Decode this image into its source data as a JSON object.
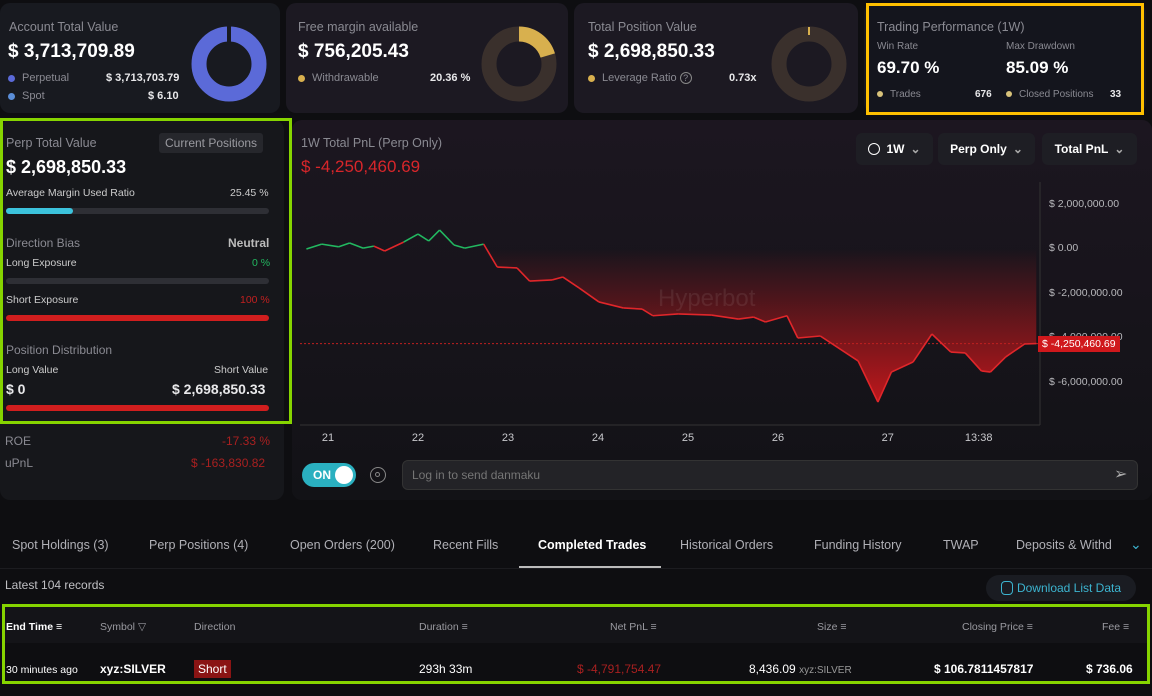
{
  "cards": {
    "account": {
      "title": "Account Total Value",
      "value": "$ 3,713,709.89",
      "rows": [
        {
          "label": "Perpetual",
          "value": "$ 3,713,703.79"
        },
        {
          "label": "Spot",
          "value": "$ 6.10"
        }
      ]
    },
    "free_margin": {
      "title": "Free margin available",
      "value": "$ 756,205.43",
      "row": {
        "label": "Withdrawable",
        "value": "20.36 %"
      },
      "fraction": 0.2036
    },
    "position": {
      "title": "Total Position Value",
      "value": "$ 2,698,850.33",
      "row": {
        "label": "Leverage Ratio",
        "value": "0.73x"
      }
    },
    "performance": {
      "title": "Trading Performance (1W)",
      "win_rate_label": "Win Rate",
      "win_rate": "69.70 %",
      "drawdown_label": "Max Drawdown",
      "drawdown": "85.09 %",
      "trades_label": "Trades",
      "trades": "676",
      "closed_label": "Closed Positions",
      "closed": "33"
    }
  },
  "perp": {
    "title": "Perp Total Value",
    "badge": "Current Positions",
    "value": "$ 2,698,850.33",
    "margin_label": "Average Margin Used Ratio",
    "margin_value": "25.45 %",
    "margin_fraction": 0.2545,
    "bias_label": "Direction Bias",
    "bias_value": "Neutral",
    "long_exp_label": "Long Exposure",
    "long_exp_value": "0 %",
    "short_exp_label": "Short Exposure",
    "short_exp_value": "100 %",
    "dist_label": "Position Distribution",
    "long_value_label": "Long Value",
    "short_value_label": "Short Value",
    "long_value": "$ 0",
    "short_value": "$ 2,698,850.33",
    "roe_label": "ROE",
    "roe": "-17.33 %",
    "upnl_label": "uPnL",
    "upnl": "$ -163,830.82"
  },
  "chart_data": {
    "type": "area",
    "title": "1W Total PnL (Perp Only)",
    "current": "$ -4,250,460.69",
    "current_tag": "$ -4,250,460.69",
    "current_value_m": -4.25,
    "ylabel": "",
    "xlabel": "",
    "ylim_m": [
      -7.5,
      2.6
    ],
    "yticks": [
      {
        "v": 2,
        "label": "$ 2,000,000.00"
      },
      {
        "v": 0,
        "label": "$ 0.00"
      },
      {
        "v": -2,
        "label": "$ -2,000,000.00"
      },
      {
        "v": -4,
        "label": "$ -4,000,000.00"
      },
      {
        "v": -6,
        "label": "$ -6,000,000.00"
      }
    ],
    "xticks": [
      {
        "t": 0,
        "label": "21"
      },
      {
        "t": 1,
        "label": "22"
      },
      {
        "t": 2,
        "label": "23"
      },
      {
        "t": 3,
        "label": "24"
      },
      {
        "t": 4,
        "label": "25"
      },
      {
        "t": 5,
        "label": "26"
      },
      {
        "t": 6.22,
        "label": "27"
      },
      {
        "t": 7.23,
        "label": "13:38"
      }
    ],
    "points_t_valueM": [
      [
        -0.24,
        0
      ],
      [
        -0.07,
        0.22
      ],
      [
        0.12,
        0.1
      ],
      [
        0.24,
        0.27
      ],
      [
        0.39,
        0.04
      ],
      [
        0.51,
        0.13
      ],
      [
        0.63,
        -0.09
      ],
      [
        0.84,
        0.31
      ],
      [
        1.0,
        0.67
      ],
      [
        1.12,
        0.36
      ],
      [
        1.24,
        0.85
      ],
      [
        1.4,
        0.18
      ],
      [
        1.52,
        0.04
      ],
      [
        1.73,
        0.22
      ],
      [
        1.88,
        -0.81
      ],
      [
        2.1,
        -0.85
      ],
      [
        2.24,
        -1.44
      ],
      [
        2.49,
        -1.39
      ],
      [
        2.61,
        -1.26
      ],
      [
        2.79,
        -1.75
      ],
      [
        3.01,
        -2.38
      ],
      [
        3.28,
        -2.65
      ],
      [
        3.49,
        -2.7
      ],
      [
        3.61,
        -3.0
      ],
      [
        3.89,
        -2.92
      ],
      [
        4.26,
        -2.97
      ],
      [
        4.56,
        -3.15
      ],
      [
        4.73,
        -3.06
      ],
      [
        4.86,
        -3.28
      ],
      [
        5.1,
        -3.0
      ],
      [
        5.22,
        -4.0
      ],
      [
        5.47,
        -3.91
      ],
      [
        5.89,
        -5.03
      ],
      [
        6.11,
        -6.88
      ],
      [
        6.26,
        -5.53
      ],
      [
        6.5,
        -5.08
      ],
      [
        6.71,
        -3.82
      ],
      [
        6.92,
        -4.63
      ],
      [
        7.08,
        -4.67
      ],
      [
        7.26,
        -5.48
      ],
      [
        7.36,
        -5.53
      ],
      [
        7.53,
        -4.85
      ],
      [
        7.74,
        -4.27
      ],
      [
        7.87,
        -4.25
      ]
    ],
    "watermark": "Hyperbot",
    "colors": {
      "up": "#22b860",
      "down": "#e0262a"
    }
  },
  "controls": {
    "range": "1W",
    "scope": "Perp Only",
    "metric": "Total PnL",
    "toggle": "ON",
    "danmaku_placeholder": "Log in to send danmaku"
  },
  "tabs": [
    "Spot Holdings (3)",
    "Perp Positions (4)",
    "Open Orders (200)",
    "Recent Fills",
    "Completed Trades",
    "Historical Orders",
    "Funding History",
    "TWAP",
    "Deposits & Withd"
  ],
  "records": "Latest 104 records",
  "download": "Download List Data",
  "table": {
    "headers": [
      "End Time",
      "Symbol",
      "Direction",
      "Duration",
      "Net PnL",
      "Size",
      "Closing Price",
      "Fee"
    ],
    "rows": [
      {
        "end_time": "30 minutes ago",
        "symbol": "xyz:SILVER",
        "direction": "Short",
        "duration": "293h 33m",
        "net_pnl": "$ -4,791,754.47",
        "size": "8,436.09",
        "size_unit": "xyz:SILVER",
        "closing_price": "$ 106.7811457817",
        "fee": "$ 736.06"
      }
    ]
  }
}
